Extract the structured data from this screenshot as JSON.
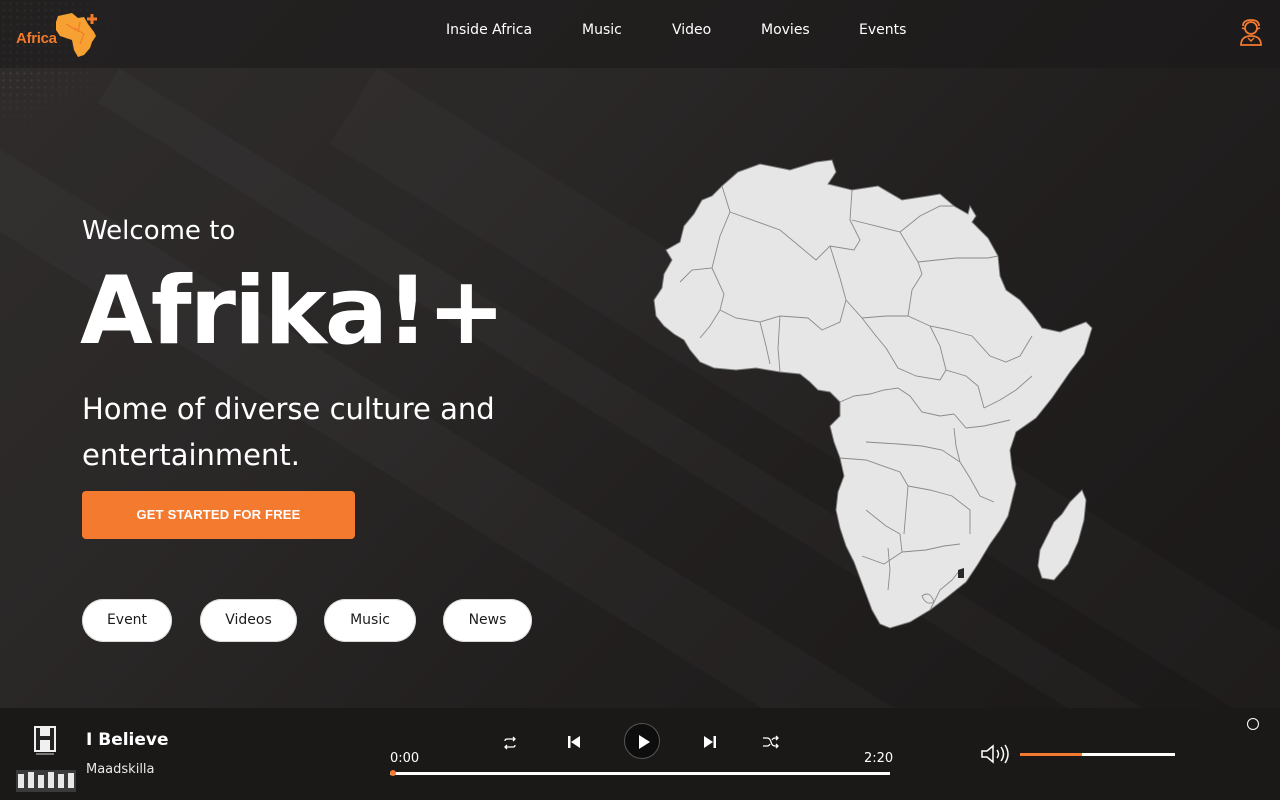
{
  "header": {
    "logo_text": "Africa",
    "logo_icon": "africa-plus-logo",
    "nav": [
      {
        "label": "Inside Africa"
      },
      {
        "label": "Music"
      },
      {
        "label": "Video"
      },
      {
        "label": "Movies"
      },
      {
        "label": "Events"
      }
    ],
    "user_icon": "user-avatar-icon"
  },
  "hero": {
    "welcome": "Welcome to",
    "brand": "Afrika!+",
    "tagline": "Home of diverse culture and entertainment.",
    "cta_label": "GET STARTED FOR FREE",
    "categories": [
      {
        "label": "Event"
      },
      {
        "label": "Videos"
      },
      {
        "label": "Music"
      },
      {
        "label": "News"
      }
    ],
    "map_icon": "africa-map"
  },
  "player": {
    "title": "I Believe",
    "artist": "Maadskilla",
    "current_time": "0:00",
    "duration": "2:20",
    "progress": 0.0,
    "volume": 0.4,
    "controls": [
      "repeat-icon",
      "previous-icon",
      "play-icon",
      "next-icon",
      "shuffle-icon"
    ],
    "volume_icon": "volume-icon"
  },
  "colors": {
    "accent": "#f47a2f",
    "background": "#232121",
    "map_fill": "#e6e6e6",
    "player_bg": "#1b1918"
  }
}
